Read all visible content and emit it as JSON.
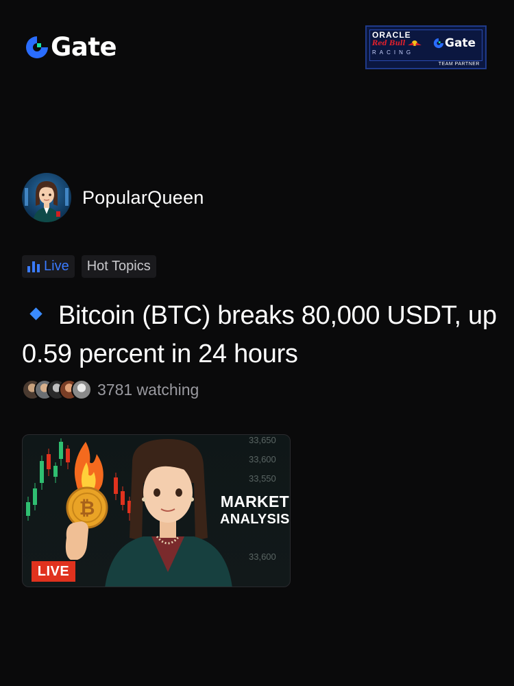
{
  "header": {
    "logo_text": "Gate",
    "partner_badge": {
      "line1": "ORACLE",
      "line2": "Red Bull",
      "line3": "RACING",
      "brand": "Gate",
      "caption": "TEAM PARTNER"
    }
  },
  "author": {
    "name": "PopularQueen"
  },
  "tags": {
    "live": "Live",
    "hot": "Hot Topics"
  },
  "post": {
    "headline": "Bitcoin (BTC) breaks 80,000 USDT, up 0.59 percent  in 24 hours",
    "watching": "3781 watching"
  },
  "thumbnail": {
    "live_label": "LIVE",
    "title_line1": "MARKET",
    "title_line2": "ANALYSIS",
    "prices": [
      "33,650",
      "33,600",
      "33,550",
      "33,600"
    ]
  },
  "colors": {
    "background": "#0a0a0b",
    "accent": "#3a7bff",
    "live_red": "#e0321e"
  },
  "icons": [
    "gate-logo-icon",
    "live-bars-icon",
    "diamond-icon",
    "bitcoin-coin-icon"
  ]
}
